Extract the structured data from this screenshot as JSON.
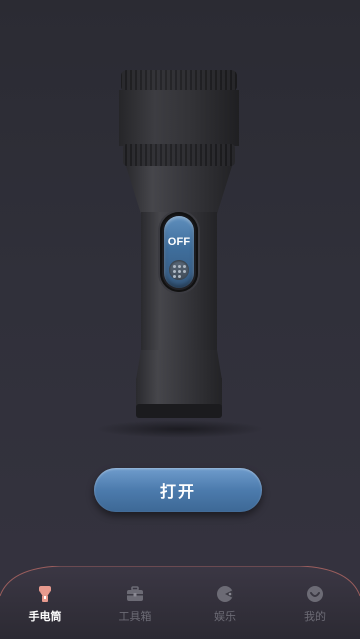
{
  "flashlight": {
    "switch_label": "OFF"
  },
  "main_button": {
    "label": "打开"
  },
  "nav": {
    "items": [
      {
        "label": "手电筒",
        "icon": "flashlight-icon",
        "active": true
      },
      {
        "label": "工具箱",
        "icon": "toolbox-icon",
        "active": false
      },
      {
        "label": "娱乐",
        "icon": "gamepad-icon",
        "active": false
      },
      {
        "label": "我的",
        "icon": "profile-icon",
        "active": false
      }
    ]
  },
  "colors": {
    "accent": "#4c7bad",
    "active_icon": "#e79a8e",
    "inactive": "#6c6b75",
    "nav_border": "#c46f6a"
  }
}
